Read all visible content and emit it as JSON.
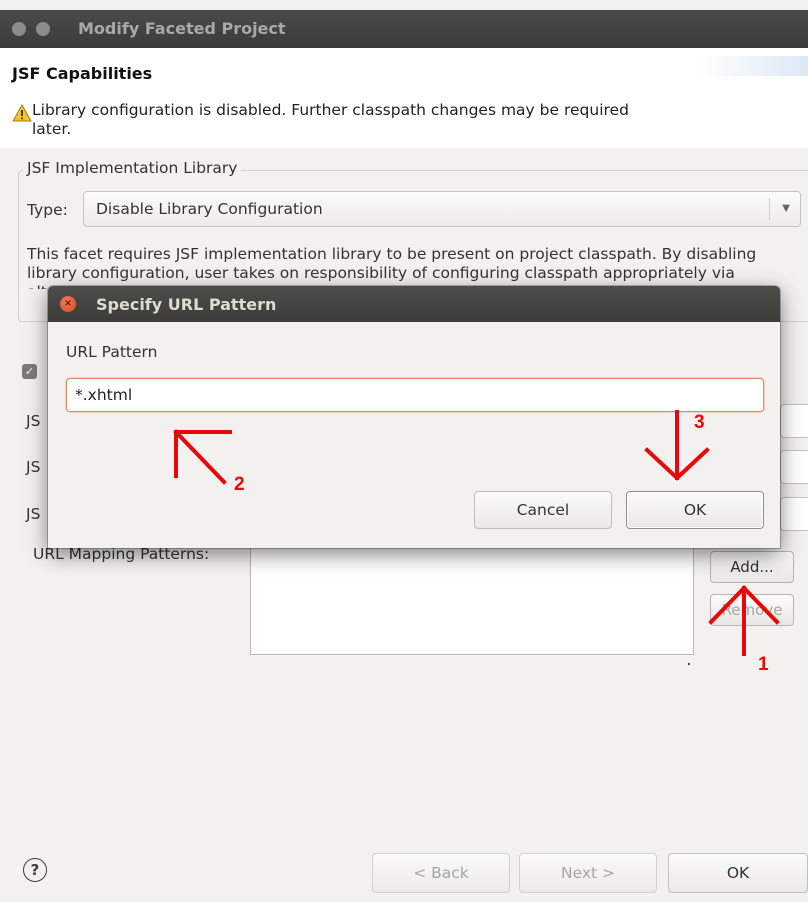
{
  "window": {
    "title": "Modify Faceted Project"
  },
  "header": {
    "heading": "JSF Capabilities",
    "warning": "Library configuration is disabled. Further classpath changes may be required later."
  },
  "library_group": {
    "legend": "JSF Implementation Library",
    "type_label": "Type:",
    "type_value": "Disable Library Configuration",
    "description": "This facet requires JSF implementation library to be present on project classpath. By disabling library configuration, user takes on responsibility of configuring classpath appropriately via alternate means."
  },
  "background_rows": {
    "row1_label": "JS",
    "row2_label": "JS",
    "row3_label": "JS",
    "url_mapping_label": "URL Mapping Patterns:",
    "add_label": "Add...",
    "remove_label": "Remove"
  },
  "dialog": {
    "title": "Specify URL Pattern",
    "field_label": "URL Pattern",
    "field_value": "*.xhtml",
    "cancel_label": "Cancel",
    "ok_label": "OK"
  },
  "footer": {
    "help_symbol": "?",
    "back_label": "< Back",
    "next_label": "Next >",
    "ok_label": "OK"
  },
  "annotations": {
    "step1": "1",
    "step2": "2",
    "step3": "3",
    "color": "#e8080a"
  },
  "colors": {
    "titlebar": "#3b3b38",
    "dialog_close": "#d9481f",
    "input_focus": "#e58a5c"
  }
}
